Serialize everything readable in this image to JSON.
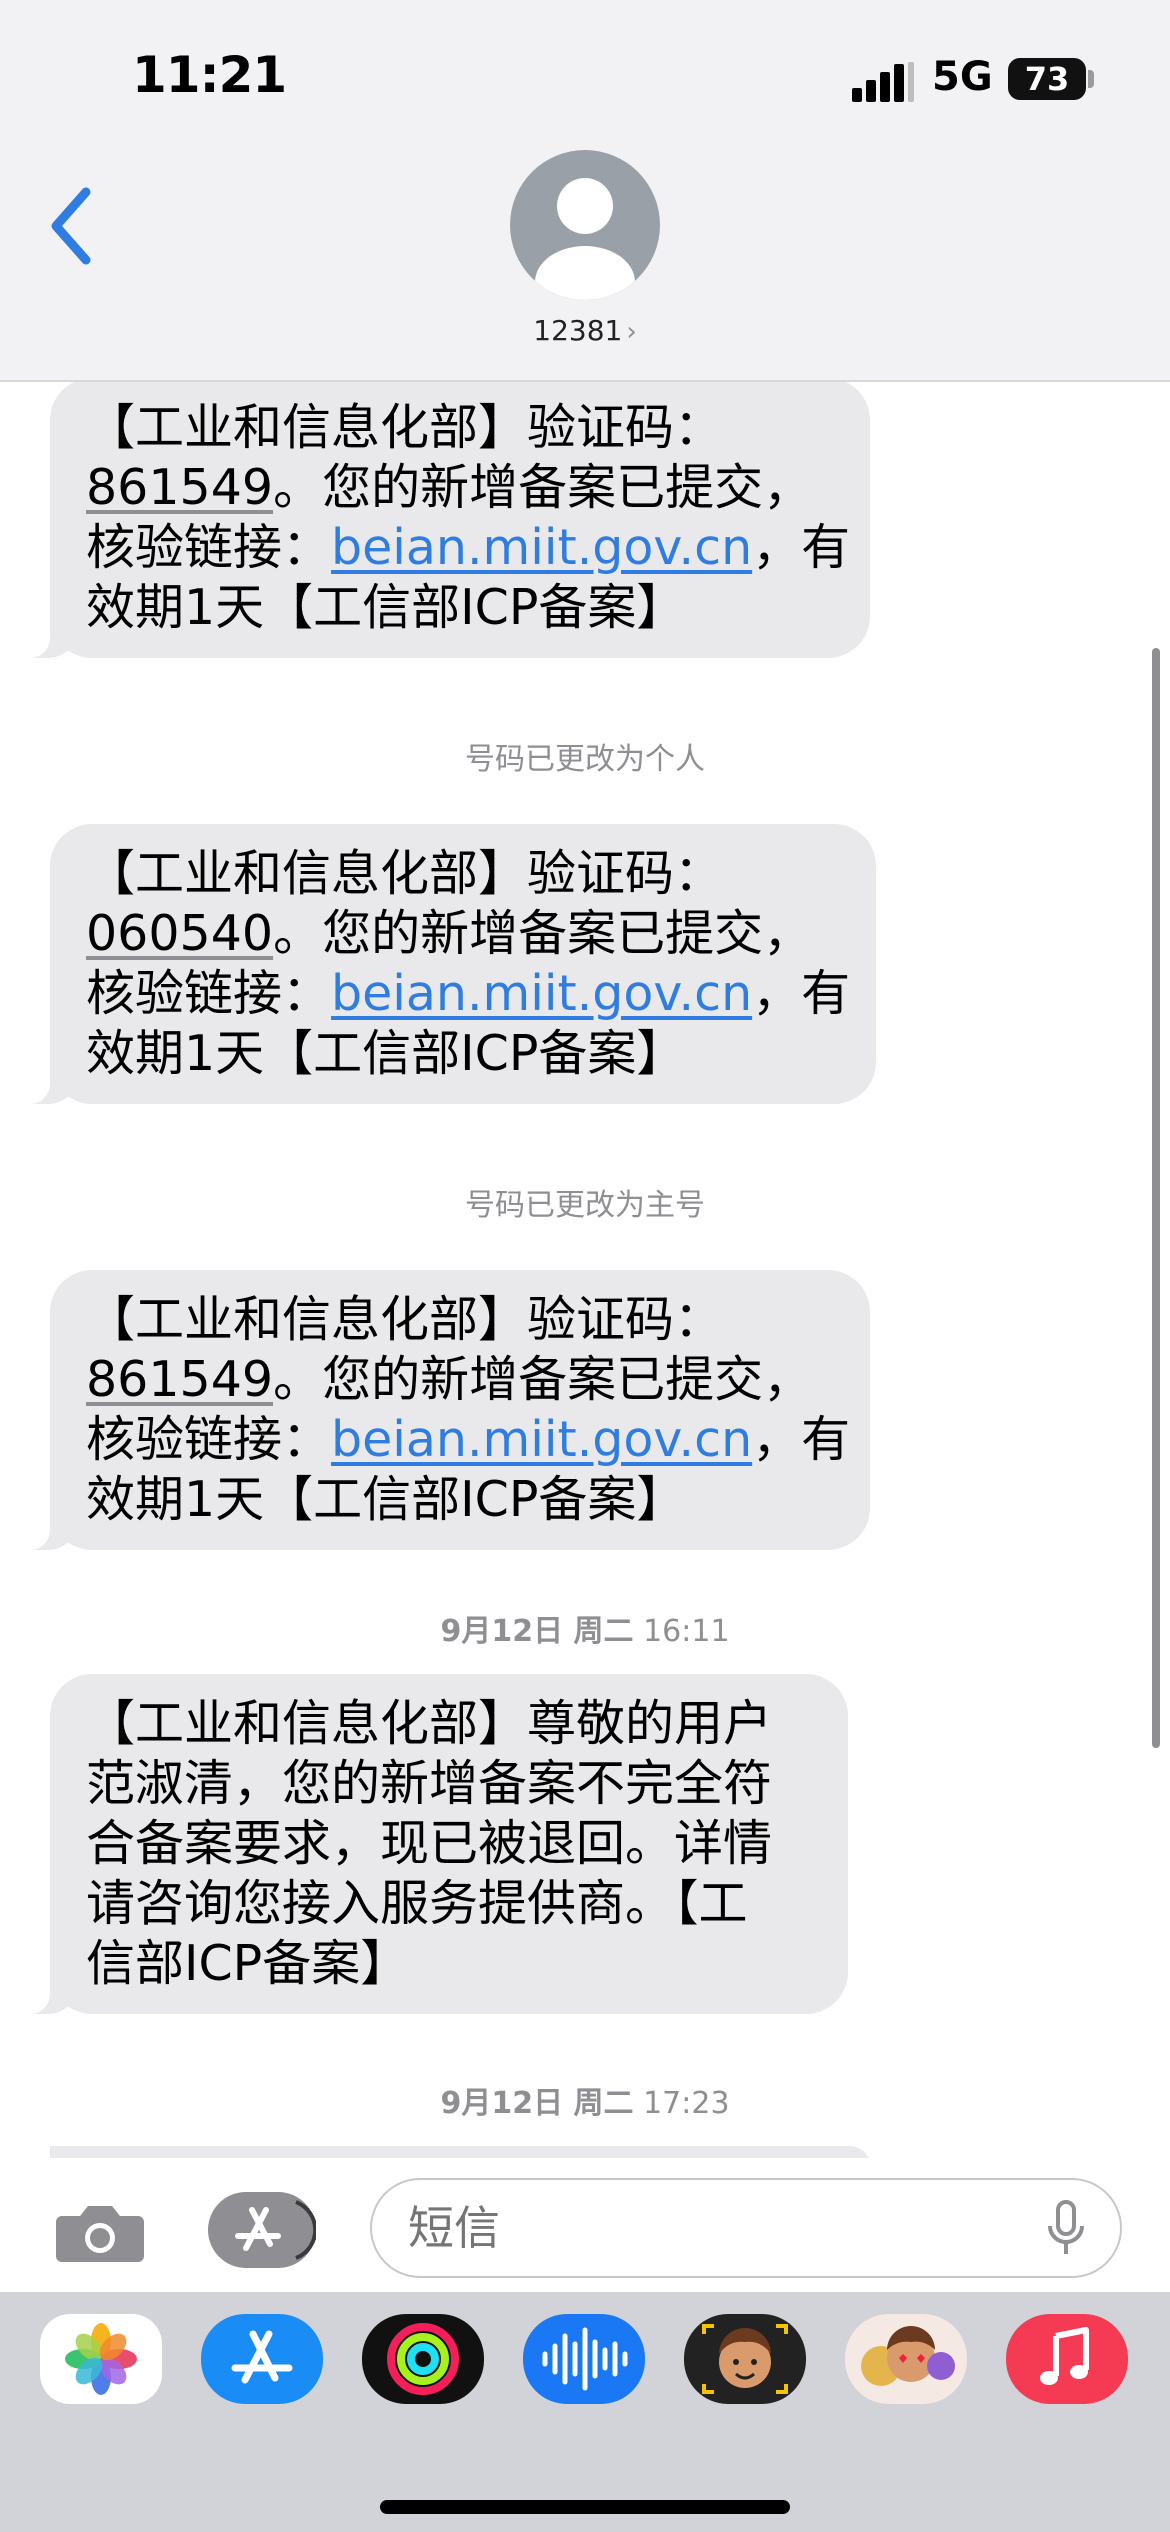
{
  "status_bar": {
    "time": "11:21",
    "network": "5G",
    "battery": "73"
  },
  "header": {
    "contact": "12381",
    "back_icon": "chevron-left-icon",
    "avatar_icon": "person-silhouette-icon"
  },
  "messages": [
    {
      "type": "bubble",
      "lines": [
        [
          {
            "t": "【工业和信息化部】验证码："
          }
        ],
        [
          {
            "t": "861549",
            "s": "code"
          },
          {
            "t": "。您的新增备案已提交，"
          }
        ],
        [
          {
            "t": "核验链接："
          },
          {
            "t": "beian.miit.gov.cn",
            "s": "link"
          },
          {
            "t": "，有"
          }
        ],
        [
          {
            "t": "效期1天【工信部ICP备案】"
          }
        ]
      ]
    },
    {
      "type": "meta",
      "text": "号码已更改为个人"
    },
    {
      "type": "bubble",
      "lines": [
        [
          {
            "t": "【工业和信息化部】验证码："
          }
        ],
        [
          {
            "t": "060540",
            "s": "code"
          },
          {
            "t": "。您的新增备案已提交，"
          }
        ],
        [
          {
            "t": "核验链接："
          },
          {
            "t": "beian.miit.gov.cn",
            "s": "link"
          },
          {
            "t": "，有"
          }
        ],
        [
          {
            "t": "效期1天【工信部ICP备案】"
          }
        ]
      ]
    },
    {
      "type": "meta",
      "text": "号码已更改为主号"
    },
    {
      "type": "bubble",
      "lines": [
        [
          {
            "t": "【工业和信息化部】验证码："
          }
        ],
        [
          {
            "t": "861549",
            "s": "code"
          },
          {
            "t": "。您的新增备案已提交，"
          }
        ],
        [
          {
            "t": "核验链接："
          },
          {
            "t": "beian.miit.gov.cn",
            "s": "link"
          },
          {
            "t": "，有"
          }
        ],
        [
          {
            "t": "效期1天【工信部ICP备案】"
          }
        ]
      ]
    },
    {
      "type": "time",
      "date": "9月12日 周二",
      "time": "16:11"
    },
    {
      "type": "bubble",
      "lines": [
        [
          {
            "t": "【工业和信息化部】尊敬的用户"
          }
        ],
        [
          {
            "t": "范淑清，您的新增备案不完全符"
          }
        ],
        [
          {
            "t": "合备案要求，现已被退回。详情"
          }
        ],
        [
          {
            "t": "请咨询您接入服务提供商。【工"
          }
        ],
        [
          {
            "t": "信部ICP备案】"
          }
        ]
      ]
    },
    {
      "type": "time",
      "date": "9月12日 周二",
      "time": "17:23"
    },
    {
      "type": "bubble",
      "lines": [
        [
          {
            "t": ""
          }
        ]
      ]
    }
  ],
  "input": {
    "placeholder": "短信",
    "camera_icon": "camera-icon",
    "apps_icon": "app-store-icon",
    "mic_icon": "microphone-icon"
  },
  "apps": [
    {
      "name": "Photos",
      "icon": "photos-icon",
      "bg": "#ffffff"
    },
    {
      "name": "App Store",
      "icon": "app-store-icon",
      "bg": "#1a8cf5"
    },
    {
      "name": "Fitness",
      "icon": "activity-rings-icon",
      "bg": "#111111"
    },
    {
      "name": "Audio Message",
      "icon": "waveform-icon",
      "bg": "#1a78f5"
    },
    {
      "name": "Memoji",
      "icon": "memoji-icon",
      "bg": "#222222"
    },
    {
      "name": "Memoji Stickers",
      "icon": "memoji-stickers-icon",
      "bg": "#f4e9e3"
    },
    {
      "name": "Music",
      "icon": "music-note-icon",
      "bg": "#f43b53"
    }
  ]
}
